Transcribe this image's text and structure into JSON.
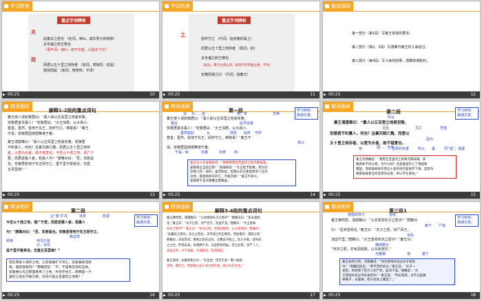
{
  "footer": {
    "time": "00:25"
  },
  "slides": [
    {
      "num": "10",
      "tab": "字词检查",
      "title": "重点字词辨析",
      "char1": "夫",
      "lines1": [
        "此庸夫之怒也 （名词，读fū，成年男子的统称）",
        "夫专诸之刺王僚也",
        "（语气词，读fú，用于句首，以提示下文）"
      ],
      "char2": "而",
      "lines2": [
        "而君以五十里之地存者 （连词，表转折，但是）",
        "挺剑而起 （连词，表修饰，不译）"
      ]
    },
    {
      "num": "11",
      "tab": "字词检查",
      "title": "重点字词辨析",
      "char": "之",
      "lines": [
        "愿终守之 （代词，指安陵的属土）",
        "而君以五十里之地存者 （助词，的）",
        "夫专诸之刺王僚也",
        "（助词，用于主谓之间，取消句子的独立性，不译）",
        "长跪而谢之曰 （代词，指秦王）"
      ]
    },
    {
      "num": "12",
      "tab": "整体感知",
      "parts": [
        "第一部分（第1段）写秦王易地的要求。",
        "第二部分（第2、3段）写唐雎与秦王的斗争经过。",
        "第三部分（第4段）写斗争的结果，唐雎取得胜利。"
      ]
    },
    {
      "num": "13",
      "tab": "精读细研",
      "title": "解释1-2段的重点词句",
      "lines": [
        "秦王使人谓安陵君曰：“寡人欲以五百里之地易安陵，",
        "安陵君其许寡人！”安陵君曰：“大王加惠，以大易小，",
        "甚善；虽然，受地于先王，愿终守之，弗敢易！”秦王",
        "不说。安陵君因使唐雎使于秦。",
        "秦王谓唐雎曰：“寡人以五百里之地易安陵，安陵君",
        "不听寡人，何也？且秦灭韩亡魏，而君以五十里之地存",
        "者，以君为长者，故不错意也。今吾以十倍之地，请广于",
        "君，而君逆寡人者，轻寡人与？”唐雎对曰：“否，非若是",
        "也。安陵君受地于先王而守之，虽千里不敢易也，岂直",
        "五百里哉？”"
      ]
    },
    {
      "num": "14",
      "tab": "精读细研",
      "title": "第一段",
      "badge": "学习目标：疏通文意。",
      "lines": [
        "秦王使人谓安陵君曰：“寡人欲以五百里之地易安陵，",
        "安陵君其许寡人！”安陵君曰：“大王加惠，以大易小，",
        "甚善；虽然，受地于先王，愿终守之，弗敢易！”秦王不",
        "说。安陵君因使唐雎使于秦。"
      ],
      "notes": [
        "派",
        "对……说",
        "用，拿",
        "交换",
        "答应",
        "给予恩惠",
        "虽然如此",
        "从",
        "情愿",
        "始终",
        "守护",
        "高兴",
        "于是，就",
        "派遣",
        "出使",
        "到"
      ],
      "box": [
        "秦王派人对安陵君说：“我想要用五百里的土地交换安陵，",
        "安陵君应当答应我！”安陵君说：“大王给予恩惠，用大的",
        "交换小的，很好；虽然如此，但我从先王那里继承了这块",
        "封地，愿意始终守护它，不敢交换！”秦王不高兴。",
        "安陵君于是派唐雎出使秦国。"
      ]
    },
    {
      "num": "15",
      "tab": "精读细研",
      "title": "第二段",
      "badge": "学习目标：疏通文意。",
      "lines": [
        "秦王谓唐雎曰：“寡人以五百里之地易安陵，",
        "安陵君不听寡人，何也？且秦灭韩亡魏，而君以",
        "五十里之地存者，以君为长者，故不错意也。"
      ],
      "notes": [
        "听从",
        "况且",
        "灭亡",
        "凭借",
        "因为",
        "把……当作",
        "忠厚的长者",
        "所以",
        "置",
        "存",
        "同“措”，放置"
      ],
      "box": [
        "秦王对唐雎说：“我用五百里的土地来交换安陵，安",
        "陵君却不听从我，为什么呢？况且秦国灭亡了韩国和",
        "魏国，而安陵君却凭借五十里的地方能够存下来，是因为",
        "我把安陵君当作忠厚的长者，所以不在意他。”"
      ]
    },
    {
      "num": "16",
      "tab": "精读细研",
      "title": "第二段",
      "badge": "学习目标：疏通文意。",
      "lines": [
        "今吾以十倍之地，请广于君，而君逆寡人者，轻寡人",
        "与？”唐雎对曰：“否，非若是也。安陵君受地于先王而守之，",
        "虽千里不敢易也，岂直五百里哉？”"
      ],
      "notes": [
        "让“我”扩充",
        "违背",
        "轻视",
        "像这样",
        "即使",
        "何况只是",
        "只，仅仅"
      ],
      "box": [
        "现在我拿十倍的土地，让安陵君扩大领土，安陵君却违抗",
        "我，是轻视我吗？”唐雎回答：“不，不是像您说的这样。",
        "安陵君从先王那里继承了土地，并且守住它，即使是一千",
        "里的土地也不敢交换，何况只是五百里的土地呢？”"
      ]
    },
    {
      "num": "17",
      "tab": "精读细研",
      "title": "解释3-4段的重点词句",
      "lines": [
        "秦王怫然怒，谓唐雎曰：“公亦尝闻天子之怒乎？”唐雎对曰：“臣未尝闻",
        "也。”秦王曰：“天子之怒，伏尸百万，流血千里。”唐雎曰：“大王尝闻",
        "布衣之怒乎？”秦王曰：“布衣之怒，亦免冠徒跣，以头抢地尔。”唐雎曰：",
        "“此庸夫之怒也，非士之怒也。夫专诸之刺王僚也，彗星袭月；聂政之刺",
        "韩傀也，白虹贯日；要离之刺庆忌也，仓鹰击于殿上。此三子者，皆布衣",
        "之士也，怀怒未发，休祲降于天，与臣而将四矣。若士必怒，伏尸二人，",
        "流血五步，天下缟素，今日是也。”挺剑而起。",
        "秦王色挠，长跪而谢之曰：“先生坐！何至于此！寡人谕矣：",
        "夫韩、魏灭亡，而安陵以五十里之地存者，徒以有先生也。”"
      ]
    },
    {
      "num": "18",
      "tab": "精读细研",
      "title": "第三段1",
      "badge": "学习目标：疏通文意。",
      "lines": [
        "秦王怫然怒，谓唐雎曰：“公亦尝闻天子之怒乎？”唐雎对",
        "曰：“臣未尝闻也。”秦王曰：“天子之怒，伏尸百万，",
        "流血千里。”唐雎曰：“大王尝闻布衣之怒乎？”秦王曰：",
        "“布衣之怒，亦免冠徒跣，以头抢地尔。”"
      ],
      "notes": [
        "愤怒的样子",
        "曾经",
        "倒下",
        "尸体",
        "平民",
        "摘掉帽子",
        "光着脚",
        "撞",
        "罢了"
      ],
      "box": [
        "秦王勃然大怒，对唐雎说：“你也曾经听说过天子发怒",
        "吗？”唐雎回答说：“我不曾听说过。”秦王说：“天子一",
        "发怒，将会倒下百万人的尸体，血流千里。”唐雎说：“大",
        "王曾经听说过平民发怒吗？”秦王说：“平民发怒，也不过是摘",
        "掉帽子，光着脚，把头往地上撞罢了。”"
      ]
    }
  ]
}
